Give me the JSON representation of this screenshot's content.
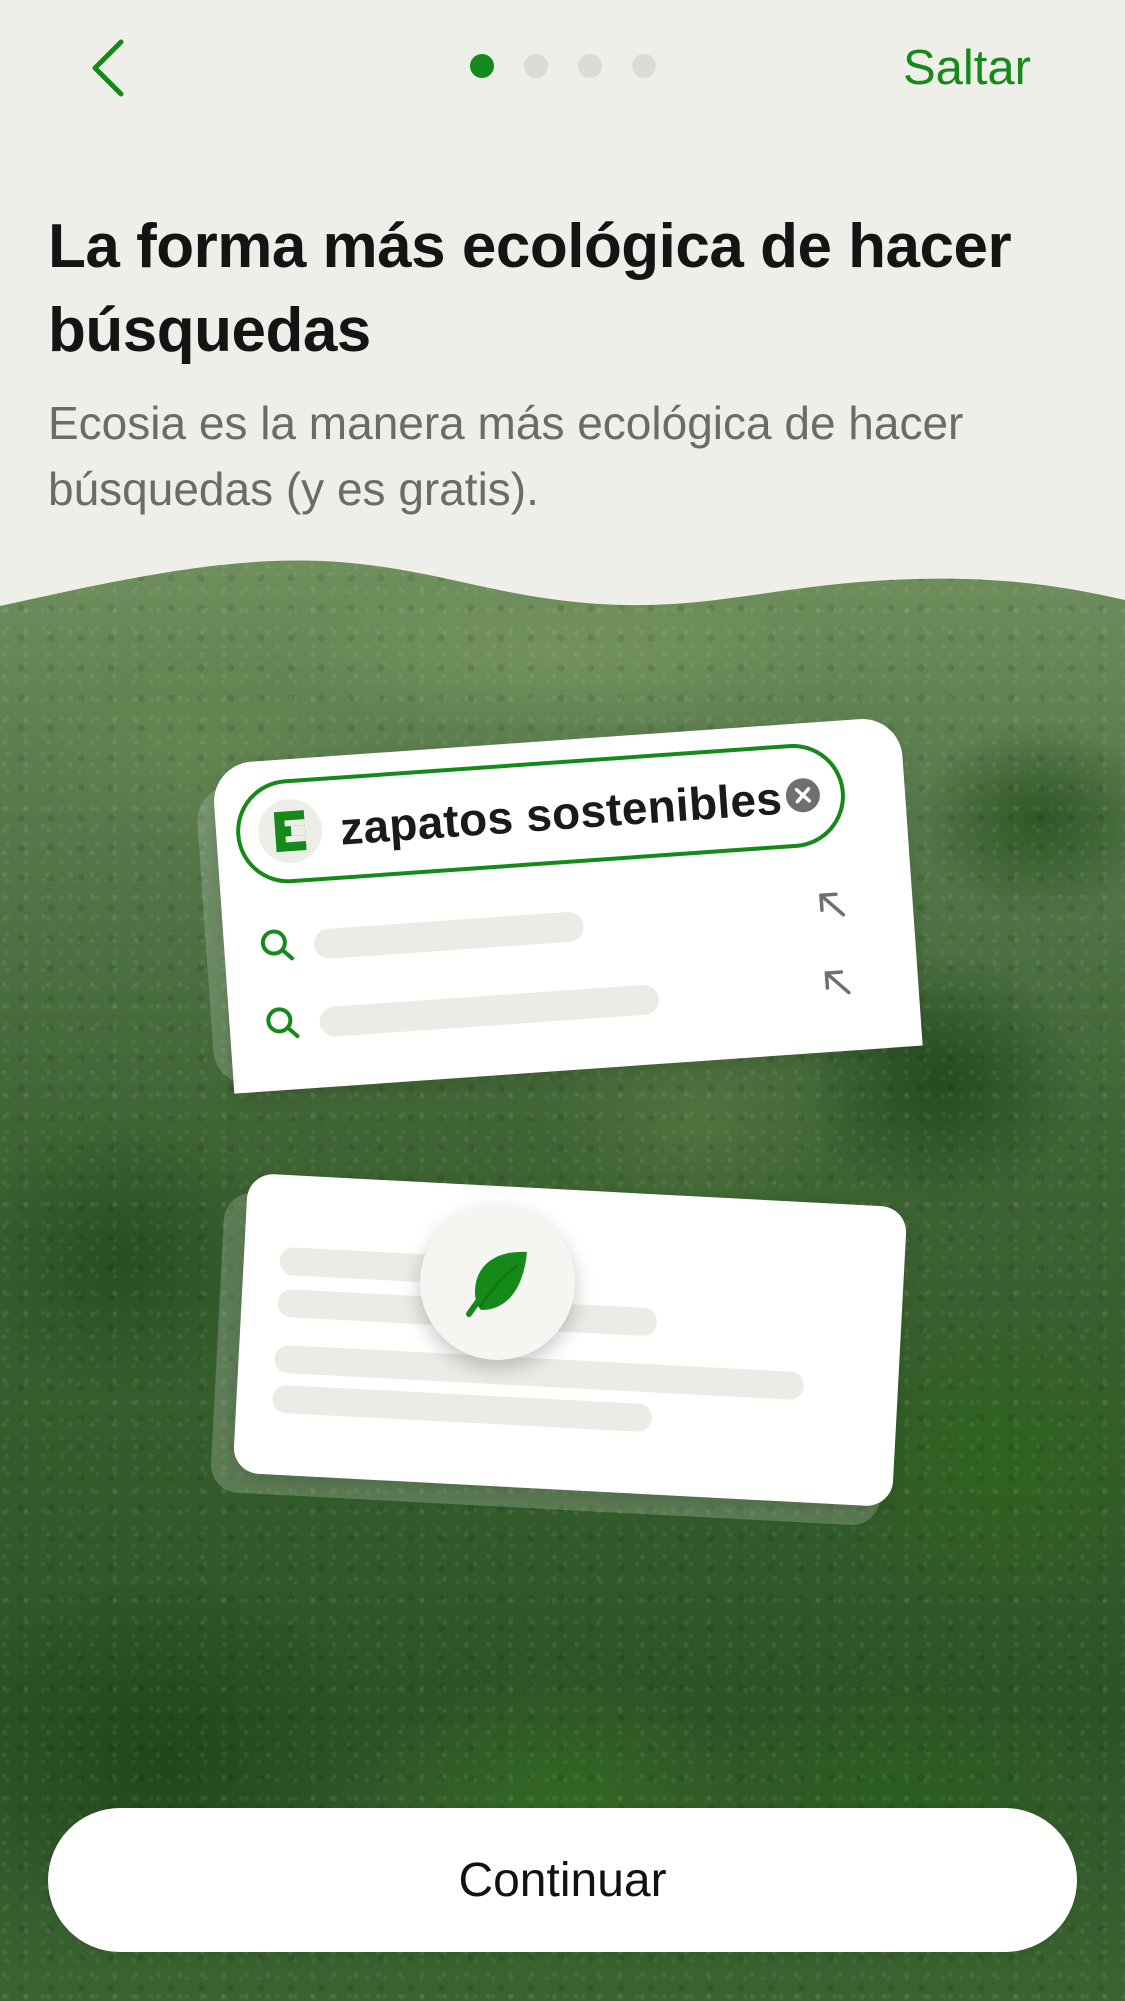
{
  "nav": {
    "back_icon": "chevron-left-icon",
    "pagination": {
      "total": 4,
      "current": 1
    },
    "skip_label": "Saltar"
  },
  "header": {
    "title": "La forma más ecológica de hacer búsquedas",
    "subtitle": "Ecosia es la manera más ecológica de hacer búsquedas (y es gratis)."
  },
  "illustration": {
    "search_query": "zapatos sostenibles",
    "logo_letter": "E",
    "clear_icon": "close-circle-icon",
    "suggestion_icon": "search-icon",
    "suggestion_arrow_icon": "arrow-up-left-icon",
    "result_badge_icon": "leaf-icon"
  },
  "footer": {
    "continue_label": "Continuar"
  },
  "colors": {
    "accent": "#158a1a",
    "background": "#efefea",
    "placeholder": "#ecece6"
  }
}
